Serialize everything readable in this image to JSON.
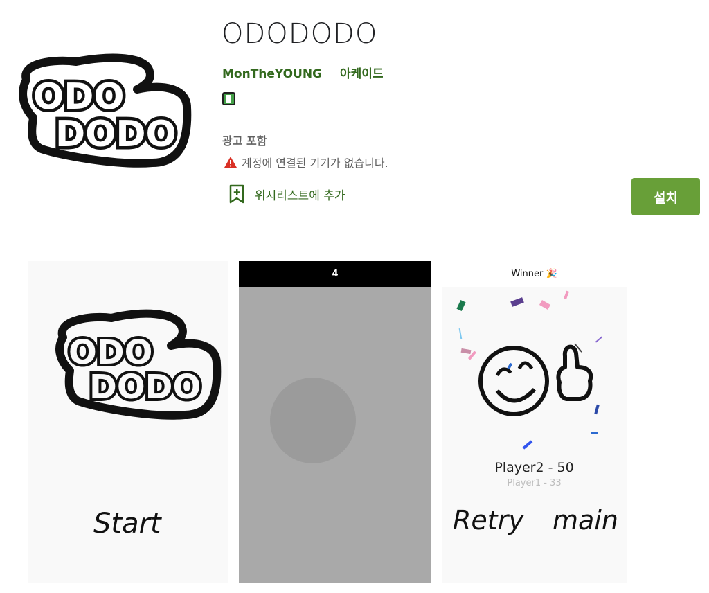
{
  "app": {
    "title": "ODODODO",
    "developer": "MonTheYOUNG",
    "category": "아케이드",
    "rating_icon": "content-rating-icon",
    "ads_label": "광고 포함",
    "warning_text": "계정에 연결된 기기가 없습니다.",
    "wishlist_label": "위시리스트에 추가",
    "install_label": "설치",
    "accent_color": "#689f38",
    "text_green": "#33691e"
  },
  "screenshots": {
    "shot1": {
      "cta": "Start"
    },
    "shot2": {
      "countdown": "4"
    },
    "shot3": {
      "status": "Winner 🎉",
      "winner_score": "Player2 - 50",
      "loser_score": "Player1 - 33",
      "retry_label": "Retry",
      "main_label": "main"
    }
  }
}
